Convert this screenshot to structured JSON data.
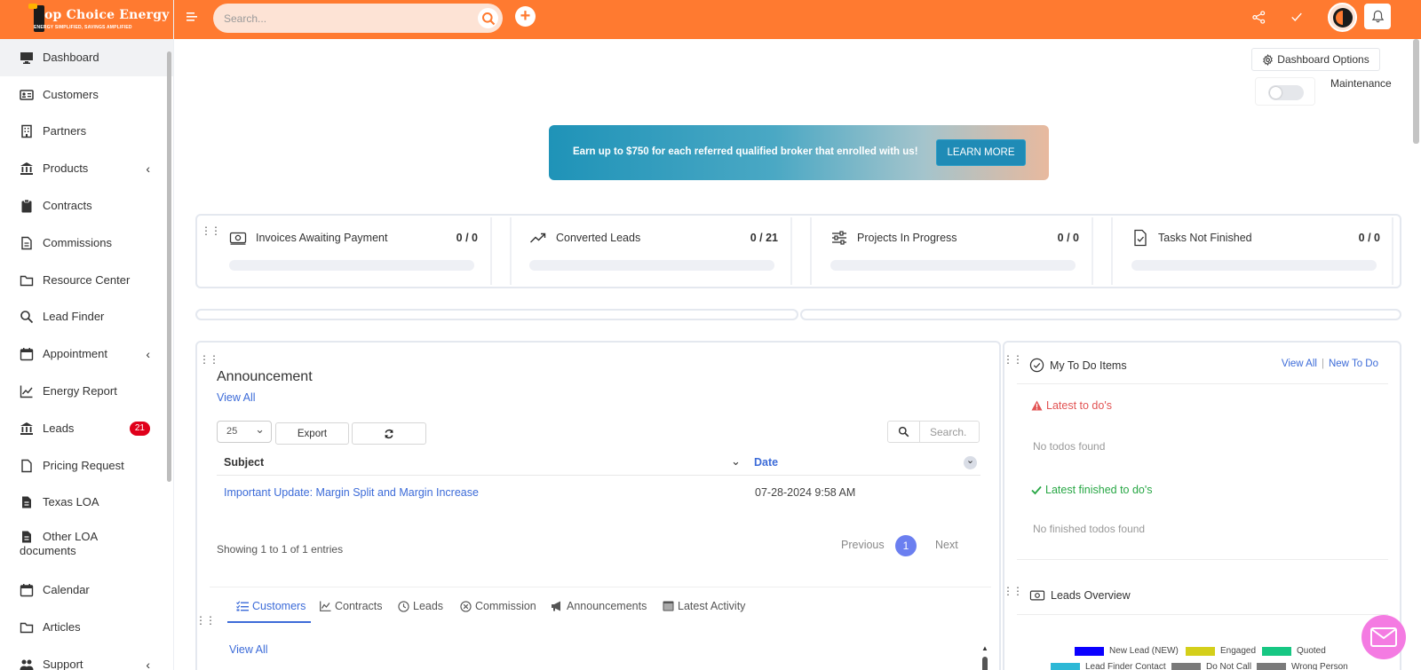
{
  "brand": {
    "name": "op Choice Energy",
    "tagline": "ENERGY SIMPLIFIED, SAVINGS AMPLIFIED",
    "color": "#ff7a30"
  },
  "sidebar": {
    "items": [
      {
        "label": "Dashboard",
        "icon": "monitor-icon"
      },
      {
        "label": "Customers",
        "icon": "id-card-icon"
      },
      {
        "label": "Partners",
        "icon": "building-icon"
      },
      {
        "label": "Products",
        "icon": "bank-icon",
        "chevron": "‹"
      },
      {
        "label": "Contracts",
        "icon": "clipboard-icon"
      },
      {
        "label": "Commissions",
        "icon": "file-icon"
      },
      {
        "label": "Resource Center",
        "icon": "folder-icon"
      },
      {
        "label": "Lead Finder",
        "icon": "search-icon"
      },
      {
        "label": "Appointment",
        "icon": "calendar-icon",
        "chevron": "‹"
      },
      {
        "label": "Energy Report",
        "icon": "line-chart-icon"
      },
      {
        "label": "Leads",
        "icon": "bank-icon",
        "badge": "21"
      },
      {
        "label": "Pricing Request",
        "icon": "file-icon"
      },
      {
        "label": "Texas LOA",
        "icon": "file-text-icon"
      },
      {
        "label": "Other LOA documents",
        "icon": "file-text-icon"
      },
      {
        "label": "Calendar",
        "icon": "calendar-icon"
      },
      {
        "label": "Articles",
        "icon": "folder-icon"
      },
      {
        "label": "Support",
        "icon": "users-icon",
        "chevron": "‹"
      }
    ]
  },
  "topbar": {
    "search_placeholder": "Search..."
  },
  "dashboard": {
    "options_label": "Dashboard Options",
    "maintenance_label": "Maintenance",
    "banner_text": "Earn up to $750 for each referred qualified broker that enrolled with us!",
    "banner_button": "LEARN MORE"
  },
  "stats": [
    {
      "label": "Invoices Awaiting Payment",
      "value": "0 / 0",
      "icon": "money-icon"
    },
    {
      "label": "Converted Leads",
      "value": "0 / 21",
      "icon": "trend-up-icon"
    },
    {
      "label": "Projects In Progress",
      "value": "0 / 0",
      "icon": "sliders-icon"
    },
    {
      "label": "Tasks Not Finished",
      "value": "0 / 0",
      "icon": "file-check-icon"
    }
  ],
  "announcement": {
    "title": "Announcement",
    "view_all": "View All",
    "page_size": "25",
    "export_label": "Export",
    "search_placeholder": "Search.",
    "columns": [
      "Subject",
      "Date"
    ],
    "rows": [
      {
        "subject": "Important Update: Margin Split and Margin Increase",
        "date": "07-28-2024 9:58 AM"
      }
    ],
    "showing": "Showing 1 to 1 of 1 entries",
    "previous": "Previous",
    "page": "1",
    "next": "Next"
  },
  "tabs": [
    {
      "label": "Customers",
      "icon": "list-check-icon"
    },
    {
      "label": "Contracts",
      "icon": "chart-icon"
    },
    {
      "label": "Leads",
      "icon": "clock-icon"
    },
    {
      "label": "Commission",
      "icon": "circle-x-icon"
    },
    {
      "label": "Announcements",
      "icon": "megaphone-icon"
    },
    {
      "label": "Latest Activity",
      "icon": "window-icon"
    }
  ],
  "tab_view_all": "View All",
  "todo": {
    "title": "My To Do Items",
    "view_all": "View All",
    "new_todo": "New To Do",
    "latest_label": "Latest to do's",
    "latest_empty": "No todos found",
    "finished_label": "Latest finished to do's",
    "finished_empty": "No finished todos found"
  },
  "leads_overview": {
    "title": "Leads Overview",
    "legend": [
      {
        "label": "New Lead (NEW)",
        "color": "#0b00ff"
      },
      {
        "label": "Engaged",
        "color": "#d4cf1a"
      },
      {
        "label": "Quoted",
        "color": "#17c783"
      },
      {
        "label": "Lead Finder Contact",
        "color": "#2db8d6"
      },
      {
        "label": "Do Not Call",
        "color": "#7a7a7a"
      },
      {
        "label": "Wrong Person",
        "color": "#7a7a7a"
      }
    ]
  }
}
